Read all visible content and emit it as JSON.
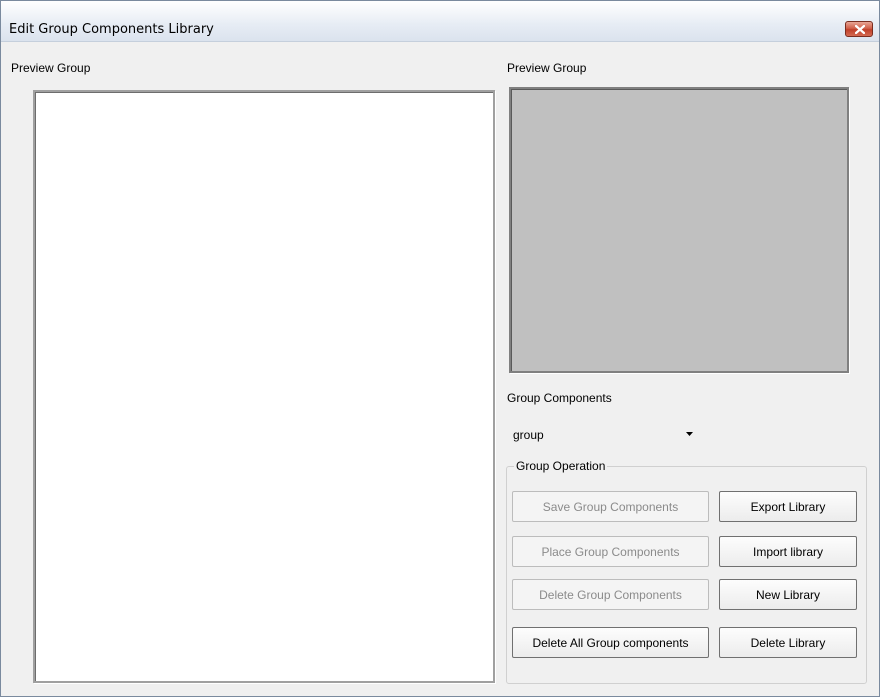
{
  "window": {
    "title": "Edit Group Components Library",
    "close_icon": "close-icon"
  },
  "left": {
    "label": "Preview Group"
  },
  "right": {
    "preview_label": "Preview Group",
    "components_label": "Group Components",
    "combo_value": "group",
    "operation_legend": "Group Operation"
  },
  "buttons": {
    "save_group": "Save Group Components",
    "place_group": "Place Group Components",
    "delete_group": "Delete Group Components",
    "delete_all_group": "Delete All Group components",
    "export_library": "Export Library",
    "import_library": "Import library",
    "new_library": "New Library",
    "delete_library": "Delete Library"
  },
  "colors": {
    "preview_background": "#c0c0c0",
    "close_button": "#c8503a"
  }
}
